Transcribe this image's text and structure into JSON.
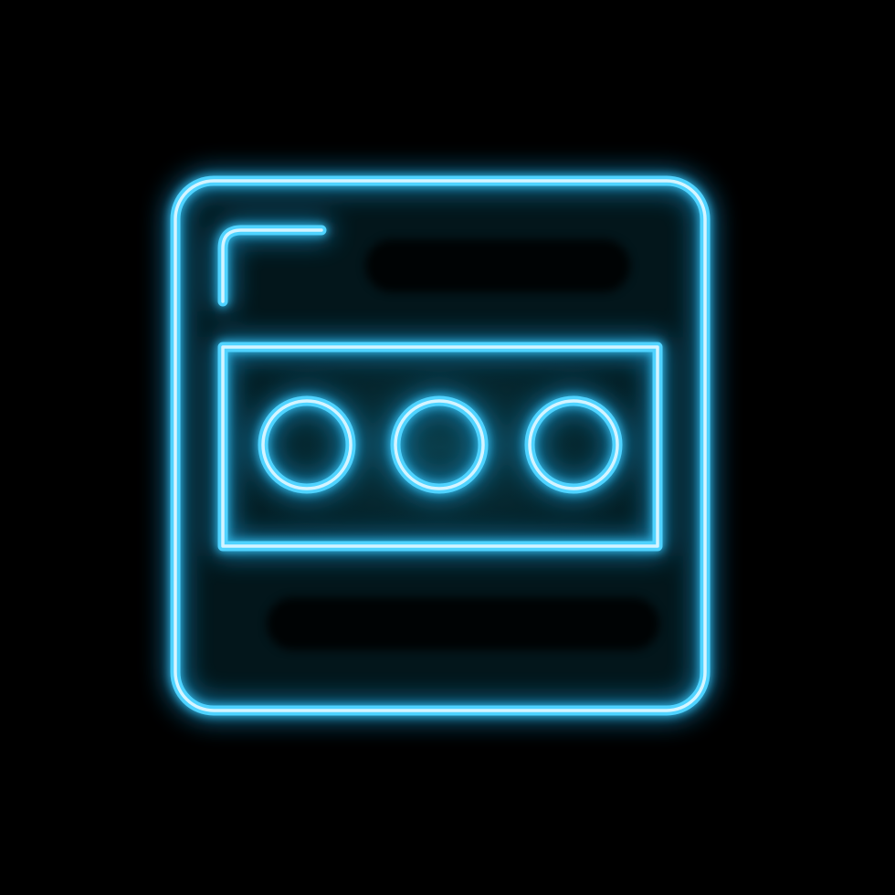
{
  "icon": {
    "name": "password-field-icon",
    "description_hidden": "",
    "glow_color": "#2fc8ff",
    "core_color": "#dff7ff",
    "background_color": "#000000",
    "masked_characters": 3
  }
}
